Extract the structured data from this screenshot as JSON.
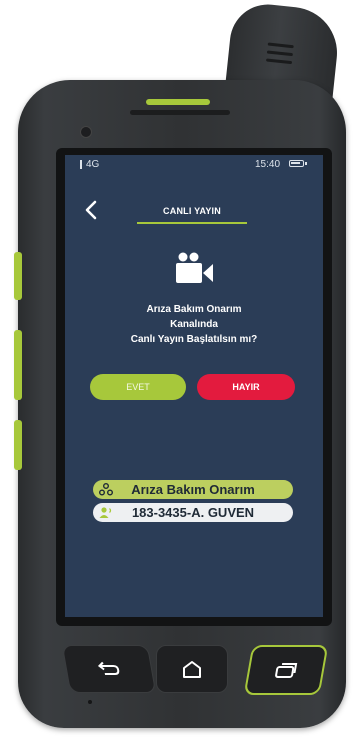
{
  "status_bar": {
    "network": "4G",
    "time": "15:40"
  },
  "header": {
    "title": "CANLI YAYIN"
  },
  "prompt": {
    "lines": [
      "Arıza Bakım Onarım",
      "Kanalında",
      "Canlı Yayın Başlatılsın mı?"
    ]
  },
  "buttons": {
    "yes": "EVET",
    "no": "HAYIR"
  },
  "channel": {
    "name": "Arıza Bakım Onarım"
  },
  "user": {
    "name": "183-3435-A. GUVEN"
  },
  "colors": {
    "screen_bg": "#2b3d57",
    "accent_green": "#a7c83b",
    "danger_red": "#e31b3e"
  },
  "icons": [
    "back-arrow-icon",
    "video-camera-icon",
    "group-channel-icon",
    "user-speaker-icon",
    "battery-icon",
    "hardware-back-icon",
    "hardware-home-icon",
    "hardware-recent-apps-icon"
  ]
}
